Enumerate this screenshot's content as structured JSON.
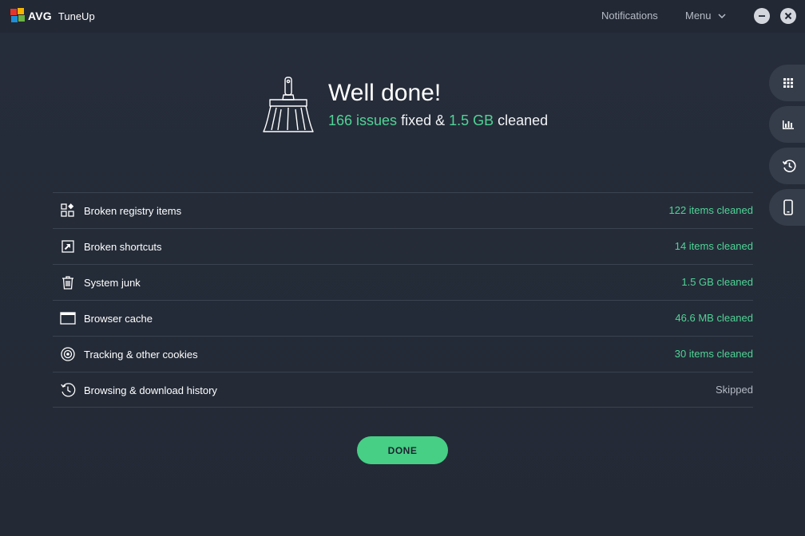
{
  "app": {
    "brand": "AVG",
    "product": "TuneUp"
  },
  "header": {
    "notifications_label": "Notifications",
    "menu_label": "Menu"
  },
  "sidebar": {
    "tabs": [
      {
        "icon": "apps-grid-icon"
      },
      {
        "icon": "performance-chart-icon"
      },
      {
        "icon": "history-icon"
      },
      {
        "icon": "mobile-device-icon"
      }
    ]
  },
  "summary": {
    "title": "Well done!",
    "issues": "166 issues",
    "fixed_text": " fixed & ",
    "size": "1.5 GB",
    "cleaned_text": " cleaned"
  },
  "results": [
    {
      "label": "Broken registry items",
      "status": "122 items cleaned",
      "icon": "registry-icon"
    },
    {
      "label": "Broken shortcuts",
      "status": "14 items cleaned",
      "icon": "shortcut-icon"
    },
    {
      "label": "System junk",
      "status": "1.5 GB cleaned",
      "icon": "trash-icon"
    },
    {
      "label": "Browser cache",
      "status": "46.6 MB cleaned",
      "icon": "browser-window-icon"
    },
    {
      "label": "Tracking & other cookies",
      "status": "30 items cleaned",
      "icon": "target-icon"
    },
    {
      "label": "Browsing & download history",
      "status": "Skipped",
      "icon": "history-clock-icon"
    }
  ],
  "done_label": "DONE",
  "colors": {
    "accent": "#46cf85",
    "highlight": "#4fd496",
    "background": "#252c38",
    "sidebar_tab": "#363d4a"
  }
}
